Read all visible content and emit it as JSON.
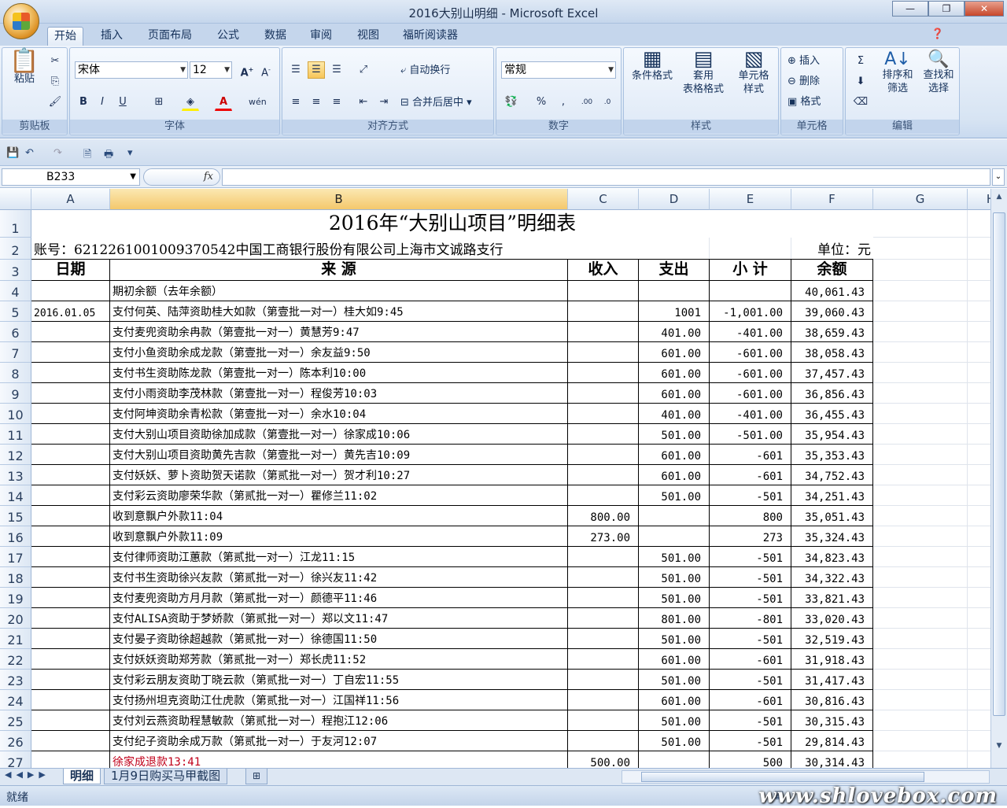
{
  "window": {
    "title": "2016大别山明细 - Microsoft Excel",
    "min": "—",
    "max": "❐",
    "close": "✕"
  },
  "tabs": [
    "开始",
    "插入",
    "页面布局",
    "公式",
    "数据",
    "审阅",
    "视图",
    "福昕阅读器"
  ],
  "ribbon": {
    "clipboard": {
      "label": "剪贴板",
      "paste": "粘贴"
    },
    "font": {
      "label": "字体",
      "name": "宋体",
      "size": "12"
    },
    "align": {
      "label": "对齐方式",
      "wrap": "自动换行",
      "merge": "合并后居中"
    },
    "number": {
      "label": "数字",
      "format": "常规"
    },
    "styles": {
      "label": "样式",
      "cond1": "条件格式",
      "table1": "套用",
      "table2": "表格格式",
      "cell1": "单元格",
      "cell2": "样式"
    },
    "cells": {
      "label": "单元格",
      "insert": "插入",
      "delete": "删除",
      "format": "格式"
    },
    "edit": {
      "label": "编辑",
      "sort1": "排序和",
      "sort2": "筛选",
      "find1": "查找和",
      "find2": "选择"
    }
  },
  "formula": {
    "namebox": "B233",
    "fx": "fx"
  },
  "columns": [
    "A",
    "B",
    "C",
    "D",
    "E",
    "F",
    "G",
    "H"
  ],
  "sheet": {
    "title": "2016年“大别山项目”明细表",
    "account": "账号：6212261001009370542中国工商银行股份有限公司上海市文诚路支行",
    "unit": "单位：元",
    "headers": {
      "date": "日期",
      "source": "来 源",
      "income": "收入",
      "expense": "支出",
      "subtotal": "小 计",
      "balance": "余额"
    },
    "rows": [
      {
        "n": "4",
        "date": "",
        "src": "期初余额（去年余额）",
        "inc": "",
        "exp": "",
        "sub": "",
        "bal": "40,061.43"
      },
      {
        "n": "5",
        "date": "2016.01.05",
        "src": "支付何英、陆萍资助桂大如款（第壹批一对一）桂大如9:45",
        "inc": "",
        "exp": "1001",
        "sub": "-1,001.00",
        "bal": "39,060.43"
      },
      {
        "n": "6",
        "date": "",
        "src": "支付麦兜资助余冉款（第壹批一对一）黄慧芳9:47",
        "inc": "",
        "exp": "401.00",
        "sub": "-401.00",
        "bal": "38,659.43"
      },
      {
        "n": "7",
        "date": "",
        "src": "支付小鱼资助余成龙款（第壹批一对一）余友益9:50",
        "inc": "",
        "exp": "601.00",
        "sub": "-601.00",
        "bal": "38,058.43"
      },
      {
        "n": "8",
        "date": "",
        "src": "支付书生资助陈龙款（第壹批一对一）陈本利10:00",
        "inc": "",
        "exp": "601.00",
        "sub": "-601.00",
        "bal": "37,457.43"
      },
      {
        "n": "9",
        "date": "",
        "src": "支付小雨资助李茂林款（第壹批一对一）程俊芳10:03",
        "inc": "",
        "exp": "601.00",
        "sub": "-601.00",
        "bal": "36,856.43"
      },
      {
        "n": "10",
        "date": "",
        "src": "支付阿坤资助余青松款（第壹批一对一）余水10:04",
        "inc": "",
        "exp": "401.00",
        "sub": "-401.00",
        "bal": "36,455.43"
      },
      {
        "n": "11",
        "date": "",
        "src": "支付大别山项目资助徐加成款（第壹批一对一）徐家成10:06",
        "inc": "",
        "exp": "501.00",
        "sub": "-501.00",
        "bal": "35,954.43"
      },
      {
        "n": "12",
        "date": "",
        "src": "支付大别山项目资助黄先吉款（第壹批一对一）黄先吉10:09",
        "inc": "",
        "exp": "601.00",
        "sub": "-601",
        "bal": "35,353.43"
      },
      {
        "n": "13",
        "date": "",
        "src": "支付妖妖、萝卜资助贺天诺款（第贰批一对一）贺才利10:27",
        "inc": "",
        "exp": "601.00",
        "sub": "-601",
        "bal": "34,752.43"
      },
      {
        "n": "14",
        "date": "",
        "src": "支付彩云资助廖荣华款（第贰批一对一）瞿修兰11:02",
        "inc": "",
        "exp": "501.00",
        "sub": "-501",
        "bal": "34,251.43"
      },
      {
        "n": "15",
        "date": "",
        "src": "收到意飘户外款11:04",
        "inc": "800.00",
        "exp": "",
        "sub": "800",
        "bal": "35,051.43"
      },
      {
        "n": "16",
        "date": "",
        "src": "收到意飘户外款11:09",
        "inc": "273.00",
        "exp": "",
        "sub": "273",
        "bal": "35,324.43"
      },
      {
        "n": "17",
        "date": "",
        "src": "支付律师资助江蕙款（第贰批一对一）江龙11:15",
        "inc": "",
        "exp": "501.00",
        "sub": "-501",
        "bal": "34,823.43"
      },
      {
        "n": "18",
        "date": "",
        "src": "支付书生资助徐兴友款（第贰批一对一）徐兴友11:42",
        "inc": "",
        "exp": "501.00",
        "sub": "-501",
        "bal": "34,322.43"
      },
      {
        "n": "19",
        "date": "",
        "src": "支付麦兜资助方月月款（第贰批一对一）颜德平11:46",
        "inc": "",
        "exp": "501.00",
        "sub": "-501",
        "bal": "33,821.43"
      },
      {
        "n": "20",
        "date": "",
        "src": "支付ALISA资助于梦娇款（第贰批一对一）郑以文11:47",
        "inc": "",
        "exp": "801.00",
        "sub": "-801",
        "bal": "33,020.43"
      },
      {
        "n": "21",
        "date": "",
        "src": "支付晏子资助徐超越款（第贰批一对一）徐德国11:50",
        "inc": "",
        "exp": "501.00",
        "sub": "-501",
        "bal": "32,519.43"
      },
      {
        "n": "22",
        "date": "",
        "src": "支付妖妖资助郑芳款（第贰批一对一）郑长虎11:52",
        "inc": "",
        "exp": "601.00",
        "sub": "-601",
        "bal": "31,918.43"
      },
      {
        "n": "23",
        "date": "",
        "src": "支付彩云朋友资助丁晓云款（第贰批一对一）丁自宏11:55",
        "inc": "",
        "exp": "501.00",
        "sub": "-501",
        "bal": "31,417.43"
      },
      {
        "n": "24",
        "date": "",
        "src": "支付扬州坦克资助江仕虎款（第贰批一对一）江国祥11:56",
        "inc": "",
        "exp": "601.00",
        "sub": "-601",
        "bal": "30,816.43"
      },
      {
        "n": "25",
        "date": "",
        "src": "支付刘云燕资助程慧敏款（第贰批一对一）程抱江12:06",
        "inc": "",
        "exp": "501.00",
        "sub": "-501",
        "bal": "30,315.43"
      },
      {
        "n": "26",
        "date": "",
        "src": "支付纪子资助余成万款（第贰批一对一）于友河12:07",
        "inc": "",
        "exp": "501.00",
        "sub": "-501",
        "bal": "29,814.43"
      },
      {
        "n": "27",
        "date": "",
        "src": "徐家成退款13:41",
        "inc": "500.00",
        "exp": "",
        "sub": "500",
        "bal": "30,314.43",
        "red": true
      }
    ]
  },
  "sheetTabs": [
    "明细",
    "1月9日购买马甲截图"
  ],
  "status": {
    "ready": "就绪",
    "watermark": "www.shlovebox.com"
  },
  "colors": {
    "accent": "#f4c86c",
    "red_text": "#c0001a"
  }
}
